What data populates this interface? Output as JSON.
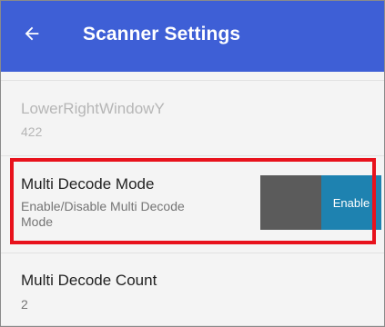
{
  "header": {
    "title": "Scanner Settings"
  },
  "settings": [
    {
      "title": "LowerRightWindowY",
      "value": "422"
    },
    {
      "title": "Multi Decode Mode",
      "description_line1": "Enable/Disable Multi Decode",
      "description_line2": "Mode",
      "toggle_label": "Enable"
    },
    {
      "title": "Multi Decode Count",
      "value": "2"
    }
  ],
  "colors": {
    "appbar": "#3e5fd6",
    "highlight": "#e8121c",
    "toggle_on": "#1e82b0",
    "toggle_off": "#5b5b5b"
  }
}
